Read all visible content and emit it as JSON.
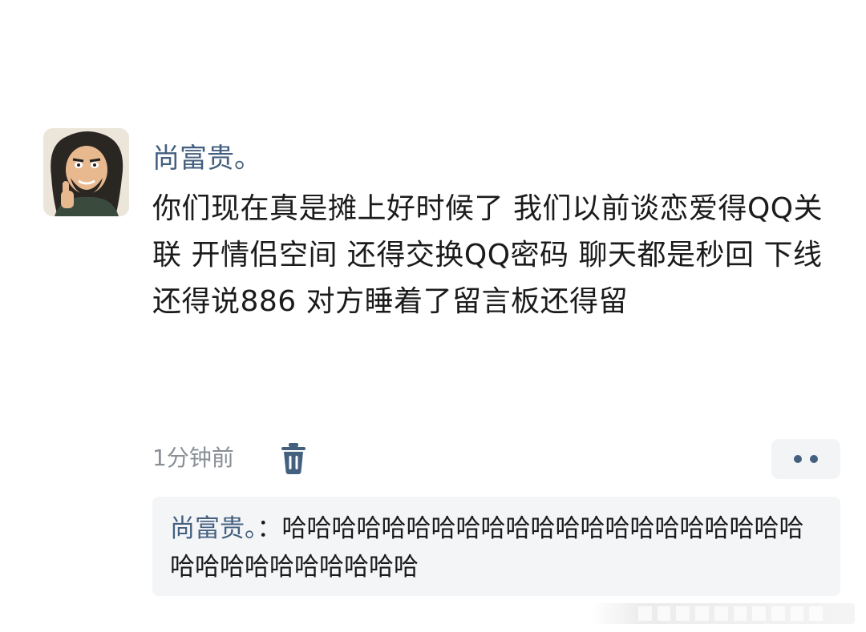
{
  "comment": {
    "avatar": "avatar-image",
    "username": "尚富贵。",
    "content": "你们现在真是摊上好时候了 我们以前谈恋爱得QQ关联 开情侣空间 还得交换QQ密码 聊天都是秒回 下线还得说886 对方睡着了留言板还得留",
    "timestamp": "1分钟前",
    "delete_icon": "trash-icon",
    "more_icon": "more-dots-icon"
  },
  "reply": {
    "username": "尚富贵。",
    "separator": "：",
    "content": "哈哈哈哈哈哈哈哈哈哈哈哈哈哈哈哈哈哈哈哈哈哈哈哈哈哈哈哈哈哈哈"
  },
  "colors": {
    "username": "#44607f",
    "text": "#1b1b1b",
    "muted": "#8a8f96",
    "reply_bg": "#f4f5f7"
  }
}
